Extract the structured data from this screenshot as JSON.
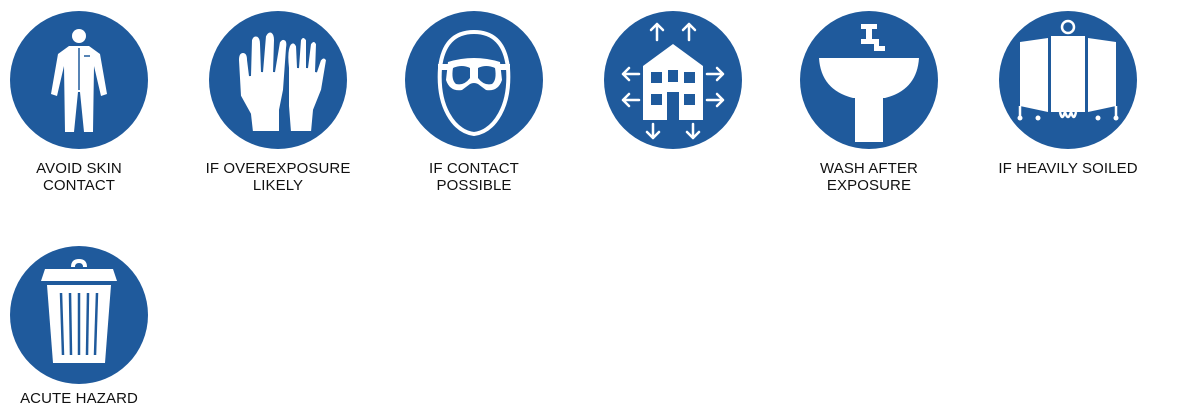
{
  "colors": {
    "sign_blue": "#1f5a9c",
    "symbol": "#ffffff",
    "text": "#111111"
  },
  "signs": [
    {
      "icon": "protective-coverall-icon",
      "caption": [
        "AVOID SKIN",
        "CONTACT"
      ]
    },
    {
      "icon": "protective-gloves-icon",
      "caption": [
        "IF OVEREXPOSURE",
        "LIKELY"
      ]
    },
    {
      "icon": "safety-goggles-icon",
      "caption": [
        "IF CONTACT",
        "POSSIBLE"
      ]
    },
    {
      "icon": "ventilation-building-icon",
      "caption": []
    },
    {
      "icon": "wash-basin-icon",
      "caption": [
        "WASH AFTER",
        "EXPOSURE"
      ]
    },
    {
      "icon": "change-screen-icon",
      "caption": [
        "IF HEAVILY SOILED"
      ]
    },
    {
      "icon": "waste-bin-icon",
      "caption": [
        "ACUTE HAZARD"
      ]
    }
  ]
}
